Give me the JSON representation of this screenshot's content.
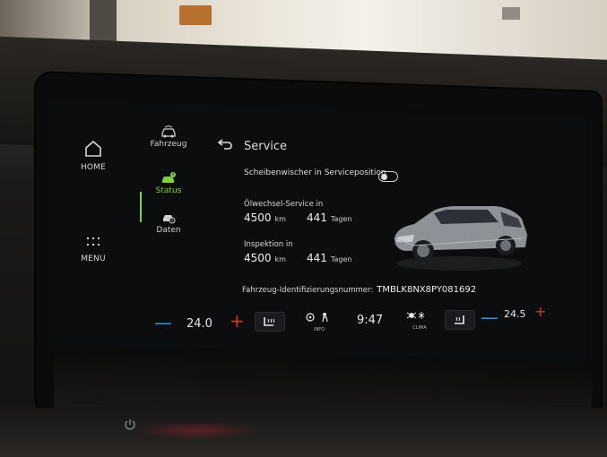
{
  "nav": {
    "home_label": "HOME",
    "menu_label": "MENU"
  },
  "tabs": [
    {
      "label": "Fahrzeug",
      "icon": "car-icon"
    },
    {
      "label": "Status",
      "icon": "car-warning-icon",
      "active": true
    },
    {
      "label": "Daten",
      "icon": "data-icon"
    }
  ],
  "page": {
    "title": "Service",
    "wiper_label": "Scheibenwischer in Serviceposition",
    "wiper_on": false,
    "oil_label": "Ölwechsel-Service in",
    "oil_km": "4500",
    "oil_days": "441",
    "inspection_label": "Inspektion in",
    "inspection_km": "4500",
    "inspection_days": "441",
    "km_unit": "km",
    "days_unit": "Tagen",
    "vin_label": "Fahrzeug-Identifizierungsnummer:",
    "vin_value": "TMBLK8NX8PY081692"
  },
  "climate": {
    "left_minus": "—",
    "left_temp": "24.0",
    "left_plus": "+",
    "seat_heat_icon": "seat-heat-icon",
    "info_label": "INFO",
    "time": "9:47",
    "climate_label": "CLIMA",
    "ac_label": "AC",
    "right_minus": "—",
    "right_temp": "24.5",
    "right_plus": "+"
  },
  "colors": {
    "accent_green": "#7fd143",
    "minus_blue": "#3d8fd6",
    "plus_red": "#e0302b"
  }
}
